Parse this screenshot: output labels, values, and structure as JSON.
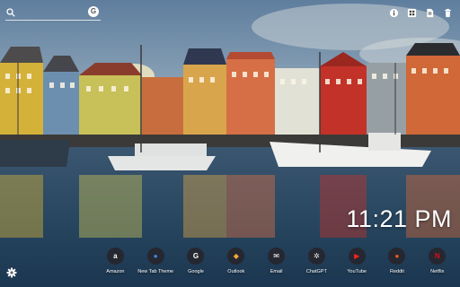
{
  "search": {
    "placeholder": "",
    "engine_badge": "G"
  },
  "top_icons": [
    "info-icon",
    "grid-icon",
    "document-icon",
    "trash-icon"
  ],
  "clock": {
    "time": "11:21 PM"
  },
  "dock": [
    {
      "label": "Amazon",
      "glyph": "a",
      "icon": "amazon-icon",
      "color": "#ffffff"
    },
    {
      "label": "New Tab Theme",
      "glyph": "●",
      "icon": "new-tab-theme-icon",
      "color": "#3d8bfd"
    },
    {
      "label": "Google",
      "glyph": "G",
      "icon": "google-icon",
      "color": "#ffffff"
    },
    {
      "label": "Outlook",
      "glyph": "◆",
      "icon": "outlook-icon",
      "color": "#f2a93b"
    },
    {
      "label": "Email",
      "glyph": "✉",
      "icon": "email-icon",
      "color": "#ffffff"
    },
    {
      "label": "ChatGPT",
      "glyph": "✲",
      "icon": "chatgpt-icon",
      "color": "#e6e6e6"
    },
    {
      "label": "YouTube",
      "glyph": "▶",
      "icon": "youtube-icon",
      "color": "#ff2020"
    },
    {
      "label": "Reddit",
      "glyph": "●",
      "icon": "reddit-icon",
      "color": "#ff5a1f"
    },
    {
      "label": "Netflix",
      "glyph": "N",
      "icon": "netflix-icon",
      "color": "#e50914"
    }
  ]
}
